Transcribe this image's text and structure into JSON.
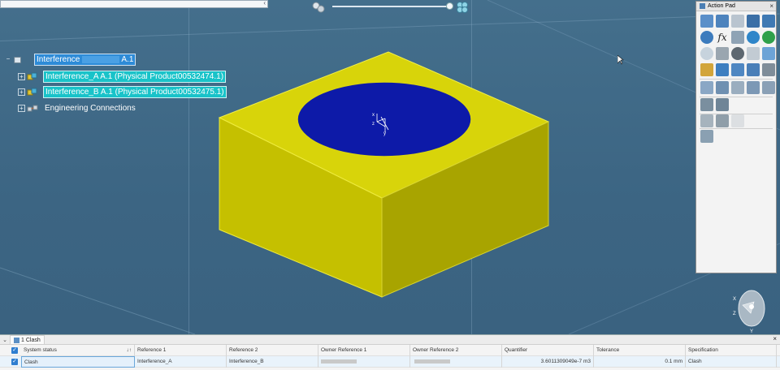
{
  "tree": {
    "root_label_prefix": "Interference",
    "root_label_suffix": "A.1",
    "items": [
      {
        "label": "Interference_A A.1 (Physical Product00532474.1)"
      },
      {
        "label": "Interference_B A.1 (Physical Product00532475.1)"
      },
      {
        "label": "Engineering Connections"
      }
    ]
  },
  "action_pad": {
    "title": "Action Pad",
    "close": "×",
    "formula_glyph": "fx"
  },
  "search_strip": {
    "close": "‹"
  },
  "bottom_panel": {
    "tab_label": "1 Clash",
    "close": "×",
    "chevron": "⌄",
    "columns": [
      "System status",
      "Reference 1",
      "Reference 2",
      "Owner Reference 1",
      "Owner Reference 2",
      "Quantifier",
      "Tolerance",
      "Specification"
    ],
    "sort_glyph": "↓↑",
    "row": {
      "checked": true,
      "system_status": "Clash",
      "reference_1": "Interference_A",
      "reference_2": "Interference_B",
      "owner_reference_1": "",
      "owner_reference_2": "",
      "quantifier": "3.6011309049e-7 m3",
      "tolerance": "0.1 mm",
      "specification": "Clash"
    }
  },
  "colors": {
    "viewport_bg": "#3f6a87",
    "box_top": "#d8d40a",
    "box_left": "#c5c000",
    "box_right": "#a8a400",
    "disc": "#0d1aa8",
    "selection_cyan": "#19c3c9",
    "selection_blue": "#2d8bd7"
  },
  "axis_labels": {
    "x": "x",
    "y": "y",
    "z": "z"
  }
}
